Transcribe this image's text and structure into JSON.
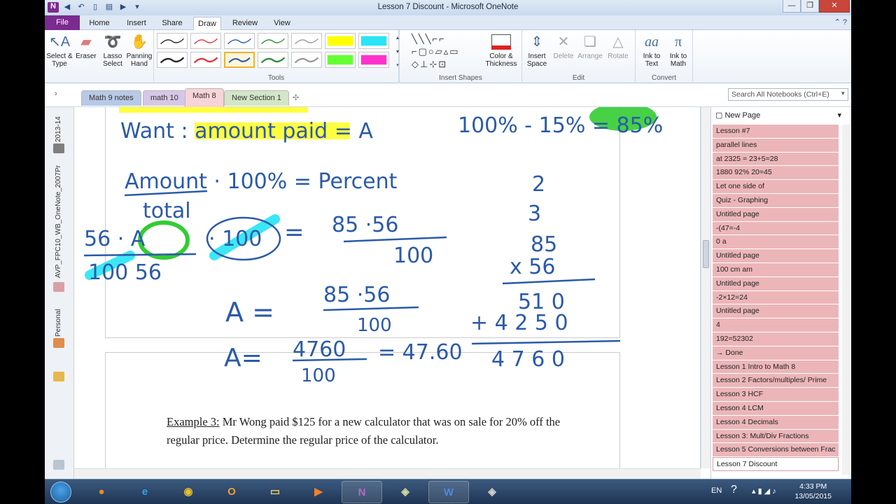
{
  "window": {
    "title": "Lesson 7 Discount - Microsoft OneNote"
  },
  "ribbon_tabs": [
    "File",
    "Home",
    "Insert",
    "Share",
    "Draw",
    "Review",
    "View"
  ],
  "active_tab": "Draw",
  "ribbon": {
    "tools": {
      "select_type": "Select & Type",
      "eraser": "Eraser",
      "lasso": "Lasso Select",
      "panning": "Panning Hand",
      "group": "Tools"
    },
    "color_thickness": "Color & Thickness",
    "insert_shapes_group": "Insert Shapes",
    "edit": {
      "insert_space": "Insert Space",
      "delete": "Delete",
      "arrange": "Arrange",
      "rotate": "Rotate",
      "group": "Edit"
    },
    "convert": {
      "ink_to_text": "Ink to Text",
      "ink_to_math": "Ink to Math",
      "group": "Convert"
    },
    "pen_colors": [
      "#222222",
      "#d9363e",
      "#2b5aa8",
      "#2e8a3c",
      "#9a9a9a",
      "#ffff00",
      "#27e5f5",
      "#222222",
      "#d9363e",
      "#2b5aa8",
      "#2e8a3c",
      "#9a9a9a",
      "#66ff33",
      "#ff33cc"
    ]
  },
  "notebook_nav": {
    "notebook_year": "2013-14",
    "notebook_name": "AVP_FPC10_WB_OneNote_2007Pr",
    "personal": "Personal"
  },
  "section_tabs": [
    {
      "label": "Math 9 notes",
      "color": "#b7c9e6"
    },
    {
      "label": "math 10",
      "color": "#d6c7e6"
    },
    {
      "label": "Math 8",
      "color": "#f2c9cd",
      "active": true
    },
    {
      "label": "New Section 1",
      "color": "#d3e6c7"
    }
  ],
  "search": {
    "placeholder": "Search All Notebooks (Ctrl+E)"
  },
  "page_list": {
    "new_page": "New Page",
    "pages": [
      "Lesson #7",
      "parallel lines",
      "at 2325 = 23+5=28",
      "1880 92% 20=45",
      "Let one side of",
      "Quiz - Graphing",
      "Untitled page",
      "-(47=-4",
      "0 a",
      "Untitled page",
      "100 cm am",
      "Untitled page",
      "-2×12=24",
      "Untitled page",
      "4",
      "192=52302",
      "→ Done",
      "Lesson 1 Intro to Math 8",
      "Lesson 2 Factors/multiples/ Prime",
      "Lesson 3 HCF",
      "Lesson 4 LCM",
      "Lesson 4 Decimals",
      "Lesson 3:  Mult/Div Fractions",
      "Lesson 5 Conversions between Frac",
      "Lesson 7 Discount"
    ],
    "selected": "Lesson 7 Discount"
  },
  "note": {
    "ink": {
      "want": "Want : amount paid = A",
      "percent_calc": "100% - 15% = 85%",
      "formula_top": "Amount · 100% = Percent",
      "formula_bottom": "total",
      "eq1_left_top": "56 · A",
      "eq1_left_bottom": "100   56",
      "eq1_mid": "· 100",
      "eq1_right_top": "85  ·56",
      "eq1_right_bottom": "100",
      "eq2": "A = 85 ·56 / 100",
      "eq3": "A = 4760 / 100 = 47.60",
      "work_top": "2",
      "work_carry": "3",
      "work_85": "85",
      "work_x56": "x 56",
      "work_510": "51 0",
      "work_4250": "+ 4 2 5 0",
      "work_4760": "4 7 6 0"
    },
    "example_label": "Example 3:",
    "example_text": " Mr Wong paid $125 for a new calculator that was on sale for 20% off the regular price.  Determine the regular price of the calculator."
  },
  "taskbar": {
    "lang": "EN",
    "time": "4:33 PM",
    "date": "13/05/2015"
  }
}
